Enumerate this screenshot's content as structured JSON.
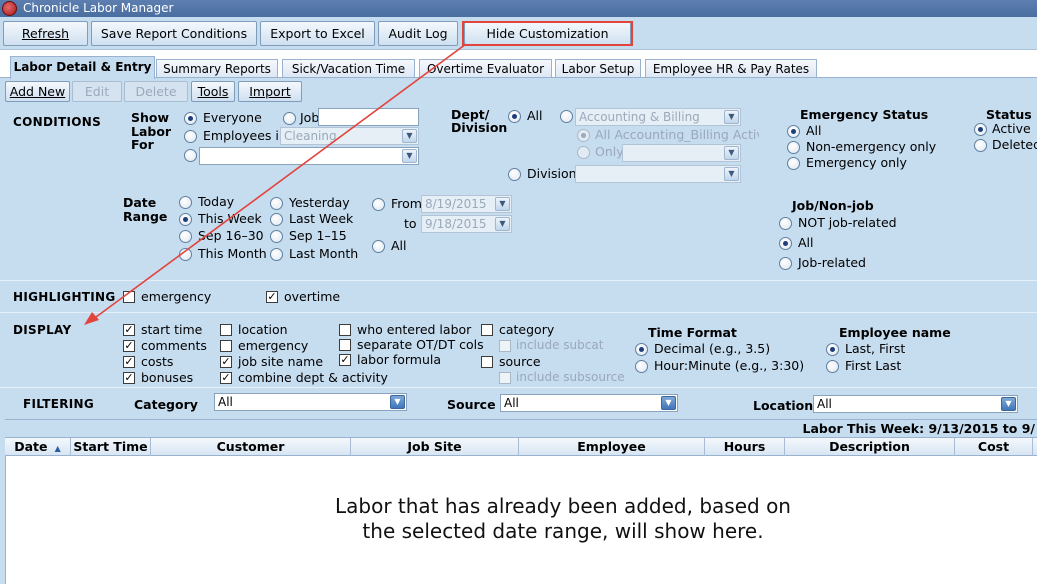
{
  "window": {
    "title": "Chronicle Labor Manager"
  },
  "toolbar": {
    "refresh": "Refresh",
    "save_conditions": "Save Report Conditions",
    "export_excel": "Export to Excel",
    "audit_log": "Audit Log",
    "hide_customization": "Hide Customization"
  },
  "tabs": [
    {
      "label": "Labor Detail & Entry"
    },
    {
      "label": "Summary Reports"
    },
    {
      "label": "Sick/Vacation Time"
    },
    {
      "label": "Overtime Evaluator"
    },
    {
      "label": "Labor Setup"
    },
    {
      "label": "Employee HR & Pay Rates"
    }
  ],
  "subtoolbar": {
    "add_new": "Add New",
    "edit": "Edit",
    "delete": "Delete",
    "tools": "Tools",
    "import": "Import"
  },
  "conditions": {
    "title": "CONDITIONS",
    "show_labor_for": {
      "label_line1": "Show",
      "label_line2": "Labor",
      "label_line3": "For",
      "everyone": "Everyone",
      "job": "Job",
      "employees_in": "Employees in",
      "employees_in_value": "Cleaning"
    },
    "dept_division": {
      "label_line1": "Dept/",
      "label_line2": "Division",
      "all": "All",
      "dept_value": "Accounting & Billing",
      "all_sub": "All Accounting_Billing Activiti",
      "only": "Only",
      "division": "Division"
    },
    "emergency_status": {
      "title": "Emergency Status",
      "all": "All",
      "non_emergency": "Non-emergency only",
      "emergency_only": "Emergency only"
    },
    "status": {
      "title": "Status",
      "active": "Active",
      "deleted": "Deleted"
    },
    "date_range": {
      "label_line1": "Date",
      "label_line2": "Range",
      "today": "Today",
      "this_week": "This Week",
      "sep_16_30": "Sep 16–30",
      "this_month": "This Month",
      "yesterday": "Yesterday",
      "last_week": "Last Week",
      "sep_1_15": "Sep 1–15",
      "last_month": "Last Month",
      "from": "From",
      "from_value": "8/19/2015",
      "to": "to",
      "to_value": "9/18/2015",
      "all": "All"
    },
    "job_nonjob": {
      "title": "Job/Non-job",
      "not_job_related": "NOT job-related",
      "all": "All",
      "job_related": "Job-related"
    }
  },
  "highlighting": {
    "title": "HIGHLIGHTING",
    "emergency": "emergency",
    "overtime": "overtime"
  },
  "display": {
    "title": "DISPLAY",
    "start_time": "start time",
    "comments": "comments",
    "costs": "costs",
    "bonuses": "bonuses",
    "location": "location",
    "emergency": "emergency",
    "job_site_name": "job site name",
    "combine_dept": "combine dept & activity",
    "who_entered": "who entered labor",
    "separate_ot": "separate OT/DT cols",
    "labor_formula": "labor formula",
    "category": "category",
    "include_subcat": "include subcat",
    "source": "source",
    "include_subsource": "include subsource",
    "time_format": {
      "title": "Time Format",
      "decimal": "Decimal (e.g., 3.5)",
      "hour_minute": "Hour:Minute (e.g., 3:30)"
    },
    "employee_name": {
      "title": "Employee name",
      "last_first": "Last, First",
      "first_last": "First Last"
    }
  },
  "filtering": {
    "title": "FILTERING",
    "category_label": "Category",
    "category_value": "All",
    "source_label": "Source",
    "source_value": "All",
    "location_label": "Location",
    "location_value": "All"
  },
  "grid": {
    "caption": "Labor This Week: 9/13/2015 to 9/",
    "columns": [
      "Date",
      "Start Time",
      "Customer",
      "Job Site",
      "Employee",
      "Hours",
      "Description",
      "Cost"
    ],
    "empty_message_line1": "Labor that has already been added, based on",
    "empty_message_line2": "the selected date range, will show here."
  },
  "colors": {
    "panel": "#c6dcef",
    "highlight_box": "#e2443c"
  }
}
